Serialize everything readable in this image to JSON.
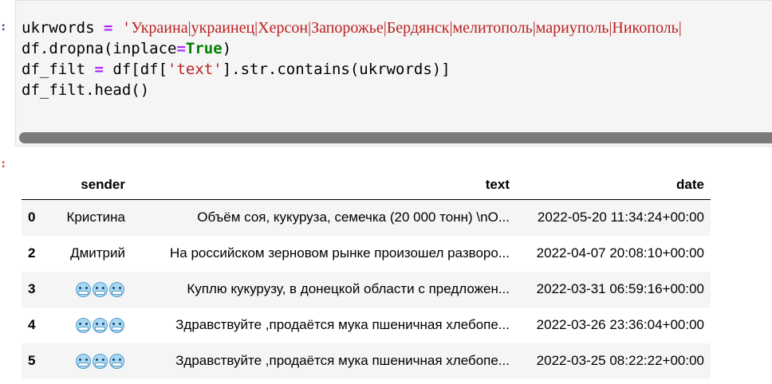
{
  "cell_in": {
    "prompt": ":",
    "lines": [
      {
        "parts": [
          {
            "t": "ukrwords ",
            "c": ""
          },
          {
            "t": "=",
            "c": "tok-op"
          },
          {
            "t": " ",
            "c": ""
          },
          {
            "t": "'",
            "c": "tok-str"
          },
          {
            "t": "Украина|украинец|Херсон|Запорожье|Бердянск|мелитополь|мариуполь|Никополь|",
            "c": "tok-str tok-serif"
          }
        ]
      },
      {
        "parts": [
          {
            "t": "df.dropna(inplace",
            "c": ""
          },
          {
            "t": "=",
            "c": "tok-op"
          },
          {
            "t": "True",
            "c": "tok-kw"
          },
          {
            "t": ")",
            "c": ""
          }
        ]
      },
      {
        "parts": [
          {
            "t": "df_filt ",
            "c": ""
          },
          {
            "t": "=",
            "c": "tok-op"
          },
          {
            "t": " df[df[",
            "c": ""
          },
          {
            "t": "'text'",
            "c": "tok-str"
          },
          {
            "t": "].str.contains(ukrwords)]",
            "c": ""
          }
        ]
      },
      {
        "parts": [
          {
            "t": "df_filt.head()",
            "c": ""
          }
        ]
      }
    ]
  },
  "cell_out": {
    "prompt": ":",
    "table": {
      "columns": [
        "",
        "sender",
        "text",
        "date"
      ],
      "rows": [
        {
          "index": "0",
          "sender": "Кристина",
          "sender_emoji_count": 0,
          "text": "Объём соя, кукуруза, семечка (20 000 тонн) \\nO...",
          "date": "2022-05-20 11:34:24+00:00"
        },
        {
          "index": "2",
          "sender": "Дмитрий",
          "sender_emoji_count": 0,
          "text": "На российском зерновом рынке произошел разворо...",
          "date": "2022-04-07 20:08:10+00:00"
        },
        {
          "index": "3",
          "sender": "",
          "sender_emoji_count": 3,
          "text": "Куплю кукурузу, в донецкой области с предложен...",
          "date": "2022-03-31 06:59:16+00:00"
        },
        {
          "index": "4",
          "sender": "",
          "sender_emoji_count": 3,
          "text": "Здравствуйте ,продаётся мука пшеничная хлебопе...",
          "date": "2022-03-26 23:36:04+00:00"
        },
        {
          "index": "5",
          "sender": "",
          "sender_emoji_count": 3,
          "text": "Здравствуйте ,продаётся мука пшеничная хлебопе...",
          "date": "2022-03-25 08:22:22+00:00"
        }
      ]
    }
  },
  "icons": {
    "sender_emoji": "cold-face-emoji-icon"
  },
  "colors": {
    "prompt_in": "#303f9f",
    "prompt_out": "#d84315",
    "string": "#ba2121",
    "keyword": "#008000",
    "operator": "#aa22ff"
  }
}
